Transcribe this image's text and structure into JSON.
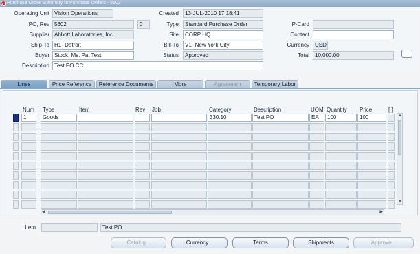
{
  "window": {
    "title": "Purchase Order Summary to Purchase Orders - 5602"
  },
  "header": {
    "operating_unit_label": "Operating Unit",
    "operating_unit": "Vision Operations",
    "created_label": "Created",
    "created": "13-JUL-2010 17:18:41",
    "po_rev_label": "PO, Rev",
    "po_number": "5602",
    "revision": "0",
    "type_label": "Type",
    "type": "Standard Purchase Order",
    "pcard_label": "P-Card",
    "pcard": "",
    "supplier_label": "Supplier",
    "supplier": "Abbott Laboratories, Inc.",
    "site_label": "Site",
    "site": "CORP HQ",
    "contact_label": "Contact",
    "contact": "",
    "ship_to_label": "Ship-To",
    "ship_to": "H1- Detroit",
    "bill_to_label": "Bill-To",
    "bill_to": "V1- New York City",
    "currency_label": "Currency",
    "currency": "USD",
    "buyer_label": "Buyer",
    "buyer": "Stock, Ms. Pat Test",
    "status_label": "Status",
    "status": "Approved",
    "total_label": "Total",
    "total": "10,000.00",
    "description_label": "Description",
    "description": "Test PO CC",
    "dff_label": "[ ]"
  },
  "tabs": [
    {
      "label": "Lines",
      "state": "active"
    },
    {
      "label": "Price Reference",
      "state": "normal"
    },
    {
      "label": "Reference Documents",
      "state": "normal"
    },
    {
      "label": "More",
      "state": "normal"
    },
    {
      "label": "Agreement",
      "state": "disabled"
    },
    {
      "label": "Temporary Labor",
      "state": "normal"
    }
  ],
  "lines": {
    "columns": [
      "Num",
      "Type",
      "Item",
      "Rev",
      "Job",
      "Category",
      "Description",
      "UOM",
      "Quantity",
      "Price",
      "[ ]"
    ],
    "rows": [
      {
        "num": "1",
        "type": "Goods",
        "item": "",
        "rev": "",
        "job": "",
        "category": "330.10",
        "description": "Test PO",
        "uom": "EA",
        "quantity": "100",
        "price": "100"
      }
    ]
  },
  "footer": {
    "item_label": "Item",
    "item_value": "",
    "item_description": "Test PO"
  },
  "buttons": {
    "catalog": "Catalog...",
    "currency": "Currency...",
    "terms": "Terms",
    "shipments": "Shipments",
    "approve": "Approve..."
  }
}
